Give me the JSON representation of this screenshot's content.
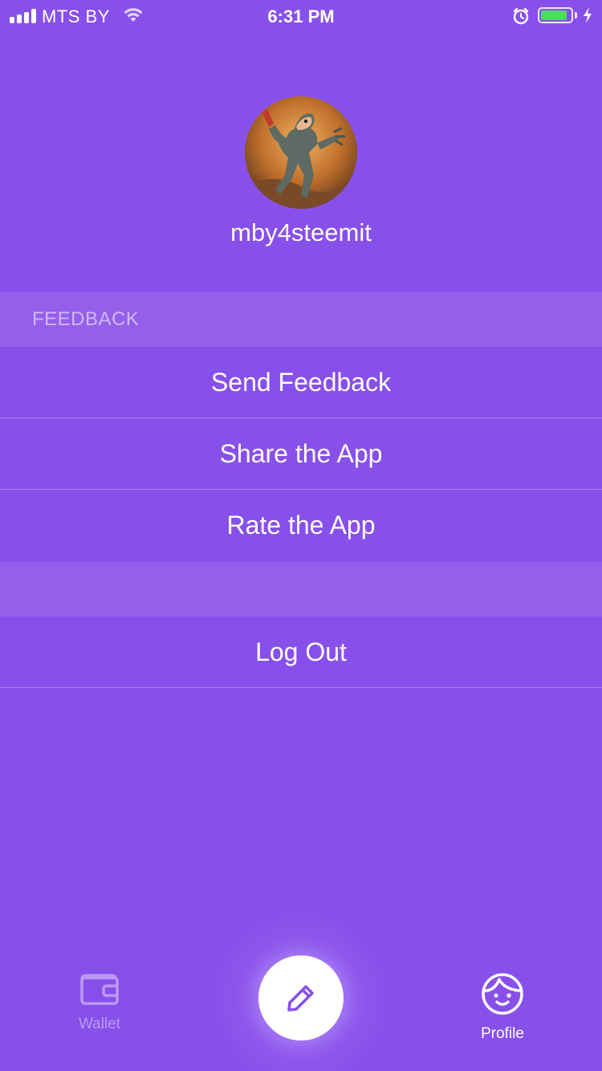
{
  "status_bar": {
    "carrier": "MTS BY",
    "time": "6:31 PM",
    "battery_level": 0.9,
    "battery_color": "#4cd964"
  },
  "profile": {
    "username": "mby4steemit",
    "avatar_icon": "avatar-image"
  },
  "sections": {
    "feedback_header": "FEEDBACK",
    "feedback_items": [
      {
        "label": "Send Feedback"
      },
      {
        "label": "Share the App"
      },
      {
        "label": "Rate the App"
      }
    ],
    "logout_label": "Log Out"
  },
  "tab_bar": {
    "wallet_label": "Wallet",
    "profile_label": "Profile",
    "compose_icon": "pencil-icon"
  },
  "colors": {
    "background": "#8850ea",
    "section_header": "#955feb",
    "header_text": "#d0b9f7",
    "inactive_tab": "#bd98f4"
  }
}
